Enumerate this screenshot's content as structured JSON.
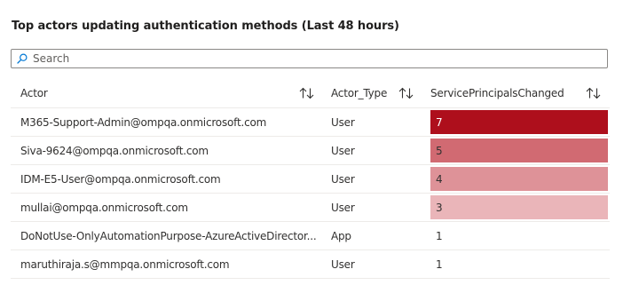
{
  "title": "Top actors updating authentication methods (Last 48 hours)",
  "search": {
    "placeholder": "Search",
    "value": ""
  },
  "columns": {
    "actor": "Actor",
    "actor_type": "Actor_Type",
    "spc": "ServicePrincipalsChanged"
  },
  "spc_max": 7,
  "colors": {
    "heat": [
      "#ffffff",
      "#eab5b9",
      "#e7a8ac",
      "#de9298",
      "#d16a72",
      "#c22e3a",
      "#ae0f1c"
    ],
    "heat_note": "color steps used by bar fills",
    "text_on_dark": "#ffffff"
  },
  "rows": [
    {
      "actor": "M365-Support-Admin@ompqa.onmicrosoft.com",
      "actor_type": "User",
      "spc": 7,
      "spc_display": "7"
    },
    {
      "actor": "Siva-9624@ompqa.onmicrosoft.com",
      "actor_type": "User",
      "spc": 5,
      "spc_display": "5"
    },
    {
      "actor": "IDM-E5-User@ompqa.onmicrosoft.com",
      "actor_type": "User",
      "spc": 4,
      "spc_display": "4"
    },
    {
      "actor": "mullai@ompqa.onmicrosoft.com",
      "actor_type": "User",
      "spc": 3,
      "spc_display": "3"
    },
    {
      "actor": "DoNotUse-OnlyAutomationPurpose-AzureActiveDirector...",
      "actor_type": "App",
      "spc": 1,
      "spc_display": "1"
    },
    {
      "actor": "maruthiraja.s@mmpqa.onmicrosoft.com",
      "actor_type": "User",
      "spc": 1,
      "spc_display": "1"
    }
  ]
}
